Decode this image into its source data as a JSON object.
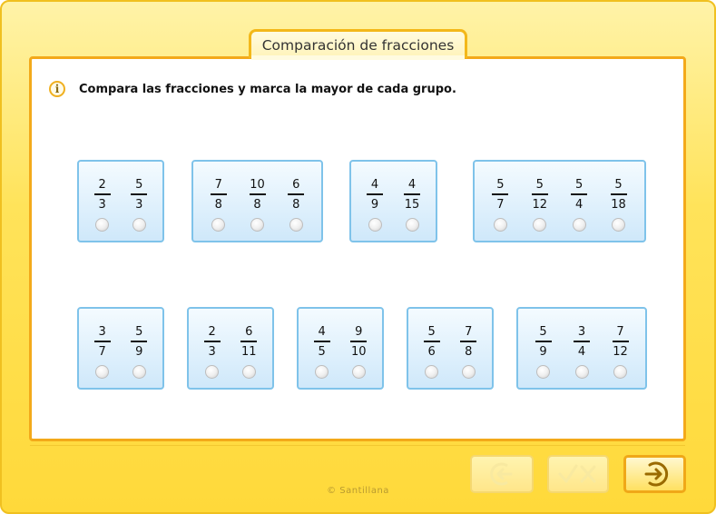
{
  "window": {
    "title": "Comparación de fracciones"
  },
  "instruction": "Compara las fracciones y marca la mayor de cada grupo.",
  "groups": [
    {
      "fractions": [
        {
          "num": "2",
          "den": "3"
        },
        {
          "num": "5",
          "den": "3"
        }
      ]
    },
    {
      "fractions": [
        {
          "num": "7",
          "den": "8"
        },
        {
          "num": "10",
          "den": "8"
        },
        {
          "num": "6",
          "den": "8"
        }
      ]
    },
    {
      "fractions": [
        {
          "num": "4",
          "den": "9"
        },
        {
          "num": "4",
          "den": "15"
        }
      ]
    },
    {
      "fractions": [
        {
          "num": "5",
          "den": "7"
        },
        {
          "num": "5",
          "den": "12"
        },
        {
          "num": "5",
          "den": "4"
        },
        {
          "num": "5",
          "den": "18"
        }
      ]
    },
    {
      "fractions": [
        {
          "num": "3",
          "den": "7"
        },
        {
          "num": "5",
          "den": "9"
        }
      ]
    },
    {
      "fractions": [
        {
          "num": "2",
          "den": "3"
        },
        {
          "num": "6",
          "den": "11"
        }
      ]
    },
    {
      "fractions": [
        {
          "num": "4",
          "den": "5"
        },
        {
          "num": "9",
          "den": "10"
        }
      ]
    },
    {
      "fractions": [
        {
          "num": "5",
          "den": "6"
        },
        {
          "num": "7",
          "den": "8"
        }
      ]
    },
    {
      "fractions": [
        {
          "num": "5",
          "den": "9"
        },
        {
          "num": "3",
          "den": "4"
        },
        {
          "num": "7",
          "den": "12"
        }
      ]
    }
  ],
  "footer": {
    "copyright": "© Santillana"
  },
  "icons": {
    "info": "info-icon",
    "back": "back-arrow-icon",
    "check": "check-cross-icon",
    "next": "next-arrow-icon"
  },
  "colors": {
    "frame": "#ffe35a",
    "panel_border": "#f3a91a",
    "group_border": "#7fc3ea"
  }
}
